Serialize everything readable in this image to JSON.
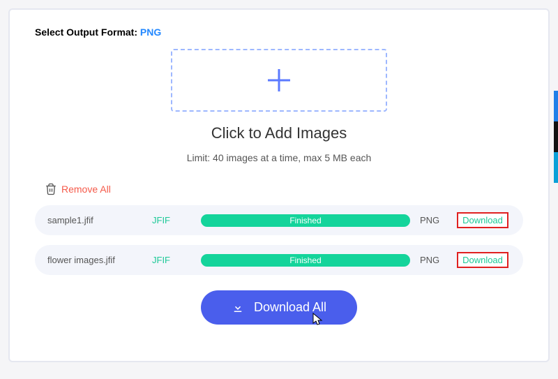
{
  "header": {
    "label": "Select Output Format:",
    "value": "PNG"
  },
  "dropzone": {
    "add_label": "Click to Add Images",
    "limit_label": "Limit: 40 images at a time, max 5 MB each"
  },
  "remove_all_label": "Remove All",
  "files": [
    {
      "name": "sample1.jfif",
      "src": "JFIF",
      "status": "Finished",
      "dst": "PNG",
      "download_label": "Download"
    },
    {
      "name": "flower images.jfif",
      "src": "JFIF",
      "status": "Finished",
      "dst": "PNG",
      "download_label": "Download"
    }
  ],
  "download_all_label": "Download All"
}
